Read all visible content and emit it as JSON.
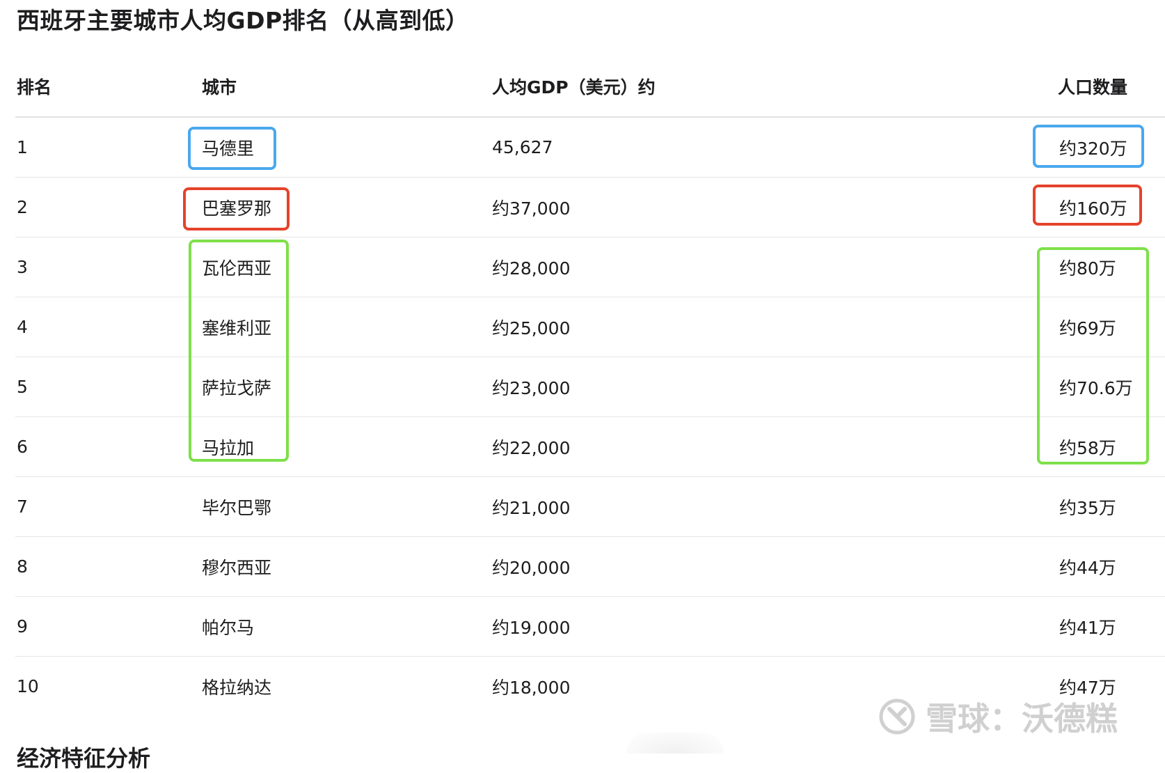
{
  "title": "西班牙主要城市人均GDP排名（从高到低）",
  "columns": {
    "rank": "排名",
    "city": "城市",
    "gdp": "人均GDP（美元）约",
    "population": "人口数量"
  },
  "rows": [
    {
      "rank": "1",
      "city": "马德里",
      "gdp": "45,627",
      "population": "约320万"
    },
    {
      "rank": "2",
      "city": "巴塞罗那",
      "gdp": "约37,000",
      "population": "约160万"
    },
    {
      "rank": "3",
      "city": "瓦伦西亚",
      "gdp": "约28,000",
      "population": "约80万"
    },
    {
      "rank": "4",
      "city": "塞维利亚",
      "gdp": "约25,000",
      "population": "约69万"
    },
    {
      "rank": "5",
      "city": "萨拉戈萨",
      "gdp": "约23,000",
      "population": "约70.6万"
    },
    {
      "rank": "6",
      "city": "马拉加",
      "gdp": "约22,000",
      "population": "约58万"
    },
    {
      "rank": "7",
      "city": "毕尔巴鄂",
      "gdp": "约21,000",
      "population": "约35万"
    },
    {
      "rank": "8",
      "city": "穆尔西亚",
      "gdp": "约20,000",
      "population": "约44万"
    },
    {
      "rank": "9",
      "city": "帕尔马",
      "gdp": "约19,000",
      "population": "约41万"
    },
    {
      "rank": "10",
      "city": "格拉纳达",
      "gdp": "约18,000",
      "population": "约47万"
    }
  ],
  "highlight_colors": {
    "blue": "#4aa8ee",
    "red": "#e5432b",
    "green": "#7ee04a"
  },
  "watermark": {
    "text": "雪球：沃德糕"
  },
  "cut_off_text": "经济特征分析"
}
